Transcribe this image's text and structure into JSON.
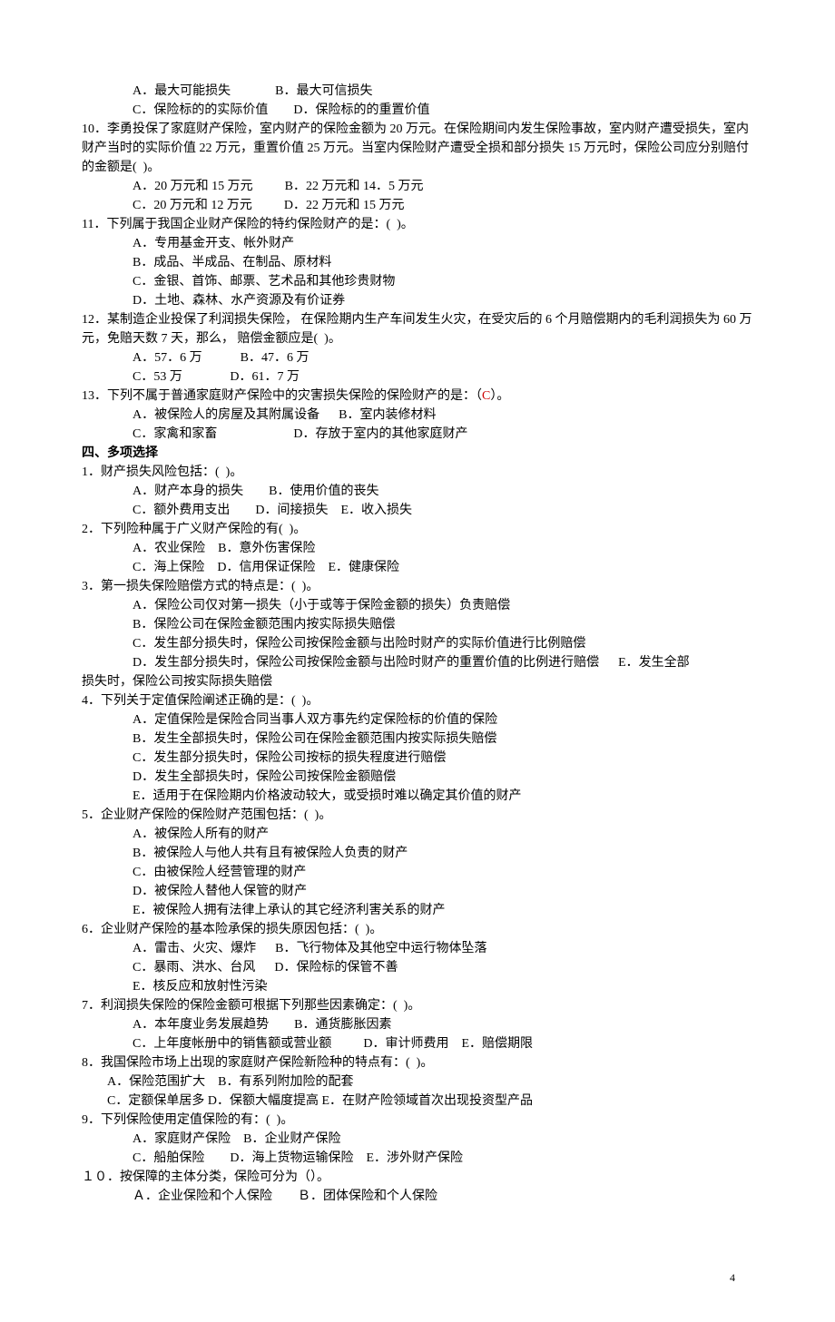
{
  "q9_opts": {
    "a": "A．最大可能损失",
    "b": "B．最大可信损失",
    "c": "C．保险标的的实际价值",
    "d": "D．保险标的的重置价值"
  },
  "q10": {
    "stem": "10．李勇投保了家庭财产保险，室内财产的保险金额为 20 万元。在保险期间内发生保险事故，室内财产遭受损失，室内财产当时的实际价值 22 万元，重置价值 25 万元。当室内保险财产遭受全损和部分损失 15 万元时，保险公司应分别赔付的金额是(  )。",
    "a": "A．20 万元和 15 万元",
    "b": "B．22 万元和 14．5 万元",
    "c": "C．20 万元和 12 万元",
    "d": "D．22 万元和 15 万元"
  },
  "q11": {
    "stem": "11．下列属于我国企业财产保险的特约保险财产的是：(  )。",
    "a": "A．专用基金开支、帐外财产",
    "b": "B．成品、半成品、在制品、原材料",
    "c": "C．金银、首饰、邮票、艺术品和其他珍贵财物",
    "d": "D．土地、森林、水产资源及有价证券"
  },
  "q12": {
    "stem": "12．某制造企业投保了利润损失保险， 在保险期内生产车间发生火灾，在受灾后的 6 个月赔偿期内的毛利润损失为 60 万元，免赔天数 7 天，那么， 赔偿金额应是(  )。",
    "a": "A．57．6 万",
    "b": "B．47．6 万",
    "c": "C．53 万",
    "d": "D．61．7 万"
  },
  "q13": {
    "stem_pre": "13．下列不属于普通家庭财产保险中的灾害损失保险的保险财产的是：（",
    "stem_mark": "C",
    "stem_post": "）。",
    "a": "A．被保险人的房屋及其附属设备",
    "b": "B．室内装修材料",
    "c": "C．家禽和家畜",
    "d": "D．存放于室内的其他家庭财产"
  },
  "section4": "四、多项选择",
  "m1": {
    "stem": "1．财产损失风险包括：(  )。",
    "a": "A．财产本身的损失",
    "b": "B．使用价值的丧失",
    "c": "C．额外费用支出",
    "d": "D．间接损失",
    "e": "E．收入损失"
  },
  "m2": {
    "stem": "2．下列险种属于广义财产保险的有(  )。",
    "a": "A．农业保险",
    "b": "B．意外伤害保险",
    "c": "C．海上保险",
    "d": "D．信用保证保险",
    "e": "E．健康保险"
  },
  "m3": {
    "stem": "3．第一损失保险赔偿方式的特点是：(  )。",
    "a": "A．保险公司仅对第一损失（小于或等于保险金额的损失）负责赔偿",
    "b": "B．保险公司在保险金额范围内按实际损失赔偿",
    "c": "C．发生部分损失时，保险公司按保险金额与出险时财产的实际价值进行比例赔偿",
    "d": "D．发生部分损失时，保险公司按保险金额与出险时财产的重置价值的比例进行赔偿",
    "e_tail": "E．发生全部",
    "e_tail2": "损失时，保险公司按实际损失赔偿"
  },
  "m4": {
    "stem": "4．下列关于定值保险阐述正确的是：(  )。",
    "a": "A．定值保险是保险合同当事人双方事先约定保险标的价值的保险",
    "b": "B．发生全部损失时，保险公司在保险金额范围内按实际损失赔偿",
    "c": "C．发生部分损失时，保险公司按标的损失程度进行赔偿",
    "d": "D．发生全部损失时，保险公司按保险金额赔偿",
    "e": "E．适用于在保险期内价格波动较大，或受损时难以确定其价值的财产"
  },
  "m5": {
    "stem": "5．企业财产保险的保险财产范围包括：(  )。",
    "a": "A．被保险人所有的财产",
    "b": "B．被保险人与他人共有且有被保险人负责的财产",
    "c": "C．由被保险人经营管理的财产",
    "d": "D．被保险人替他人保管的财产",
    "e": "E．被保险人拥有法律上承认的其它经济利害关系的财产"
  },
  "m6": {
    "stem": "6．企业财产保险的基本险承保的损失原因包括：(  )。",
    "a": "A．雷击、火灾、爆炸",
    "b": "B．飞行物体及其他空中运行物体坠落",
    "c": "C．暴雨、洪水、台风",
    "d": "D．保险标的保管不善",
    "e": "E．核反应和放射性污染"
  },
  "m7": {
    "stem": "7．利润损失保险的保险金额可根据下列那些因素确定：(  )。",
    "a": "A．本年度业务发展趋势",
    "b": "B．通货膨胀因素",
    "c": "C．上年度帐册中的销售额或营业额",
    "d": "D．审计师费用",
    "e": "E．赔偿期限"
  },
  "m8": {
    "stem": "8．我国保险市场上出现的家庭财产保险新险种的特点有：(  )。",
    "a": "A．保险范围扩大",
    "b": "B．有系列附加险的配套",
    "c": "C．定额保单居多",
    "d": "D．保额大幅度提高",
    "e": "E．在财产险领域首次出现投资型产品"
  },
  "m9": {
    "stem": "9．下列保险使用定值保险的有：(  )。",
    "a": "A．家庭财产保险",
    "b": "B．企业财产保险",
    "c": "C．船舶保险",
    "d": "D．海上货物运输保险",
    "e": "E．涉外财产保险"
  },
  "m10": {
    "stem": "１０．按保障的主体分类，保险可分为（）。",
    "a": "Ａ．企业保险和个人保险",
    "b": "Ｂ．团体保险和个人保险"
  },
  "pagenum": "4"
}
